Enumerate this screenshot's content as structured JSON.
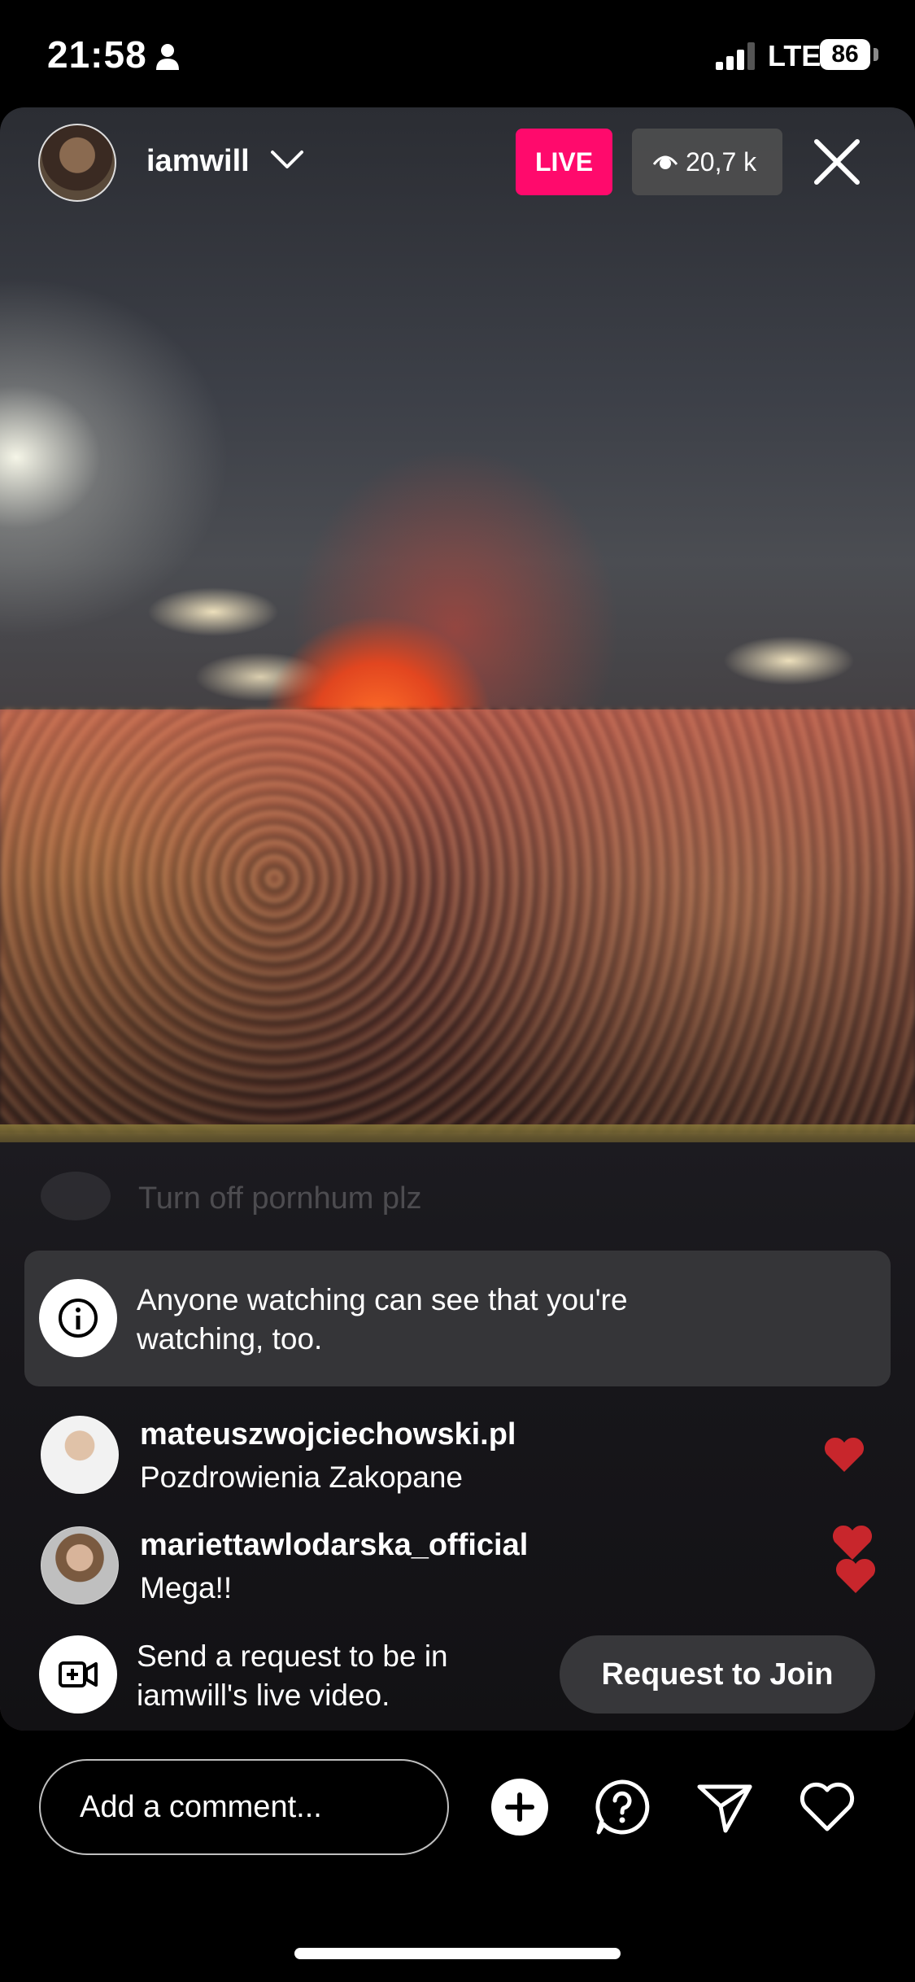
{
  "status_bar": {
    "time": "21:58",
    "network": "LTE",
    "battery": "86"
  },
  "header": {
    "host_username": "iamwill",
    "live_label": "LIVE",
    "viewer_count": "20,7 k"
  },
  "faded_comment": "Turn off pornhum plz",
  "notice": {
    "text": "Anyone watching can see that you're watching, too."
  },
  "comments": [
    {
      "username": "mateuszwojciechowski.pl",
      "text": "Pozdrowienia Zakopane"
    },
    {
      "username": "mariettawlodarska_official",
      "text": "Mega!!"
    }
  ],
  "join_request": {
    "text": "Send a request to be in iamwill's live video.",
    "button_label": "Request to Join"
  },
  "bottom_bar": {
    "comment_placeholder": "Add a comment..."
  },
  "colors": {
    "live_badge": "#ff0a6c",
    "heart": "#c8262c"
  },
  "icons": [
    "person-icon",
    "signal-icon",
    "chevron-down-icon",
    "eye-icon",
    "close-icon",
    "info-icon",
    "video-add-icon",
    "plus-icon",
    "question-icon",
    "send-icon",
    "heart-icon"
  ]
}
